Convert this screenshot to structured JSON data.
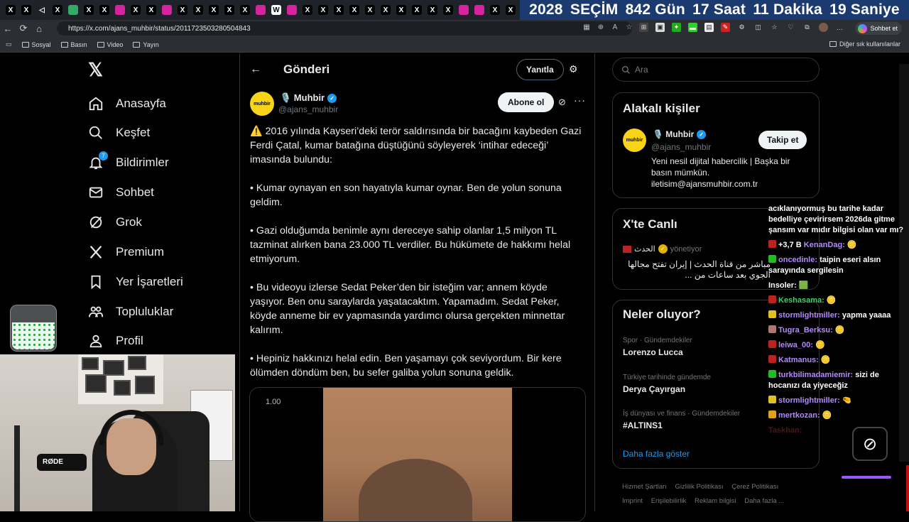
{
  "browser": {
    "tabs": [
      {
        "icon": "x-logo-icon",
        "label": "X"
      },
      {
        "icon": "x-logo-icon",
        "label": "X"
      },
      {
        "icon": "sound-icon",
        "label": ""
      },
      {
        "icon": "x-logo-icon",
        "label": "X"
      },
      {
        "icon": "bottle-icon",
        "label": ""
      },
      {
        "icon": "x-logo-icon",
        "label": "X"
      },
      {
        "icon": "x-logo-icon",
        "label": "X"
      },
      {
        "icon": "instagram-icon",
        "label": ""
      },
      {
        "icon": "x-logo-icon",
        "label": "X"
      },
      {
        "icon": "x-logo-icon",
        "label": "X"
      },
      {
        "icon": "instagram-icon",
        "label": ""
      },
      {
        "icon": "x-logo-icon",
        "label": "X"
      },
      {
        "icon": "x-logo-icon",
        "label": "X"
      },
      {
        "icon": "x-logo-icon",
        "label": "X"
      },
      {
        "icon": "x-logo-icon",
        "label": "X"
      },
      {
        "icon": "x-logo-icon",
        "label": "X"
      },
      {
        "icon": "instagram-icon",
        "label": ""
      },
      {
        "icon": "wikipedia-icon",
        "label": "W"
      },
      {
        "icon": "instagram-icon",
        "label": ""
      },
      {
        "icon": "x-logo-icon",
        "label": "X"
      },
      {
        "icon": "x-logo-icon",
        "label": "X"
      },
      {
        "icon": "x-logo-icon",
        "label": "X"
      },
      {
        "icon": "x-logo-icon",
        "label": "X"
      },
      {
        "icon": "x-logo-icon",
        "label": "X"
      },
      {
        "icon": "x-logo-icon",
        "label": "X"
      },
      {
        "icon": "x-logo-icon",
        "label": "X"
      },
      {
        "icon": "x-logo-icon",
        "label": "X"
      },
      {
        "icon": "x-logo-icon",
        "label": "X"
      },
      {
        "icon": "x-logo-icon",
        "label": "X"
      },
      {
        "icon": "instagram-icon",
        "label": ""
      },
      {
        "icon": "instagram-icon",
        "label": ""
      },
      {
        "icon": "x-logo-icon",
        "label": "X"
      },
      {
        "icon": "x-logo-icon",
        "label": "X"
      }
    ],
    "url": "https://x.com/ajans_muhbir/status/2011723503280504843",
    "copilot_label": "Sohbet et",
    "bookmarks": [
      "Sosyal",
      "Basın",
      "Video",
      "Yayın"
    ],
    "other_bookmarks": "Diğer sık kullanılanlar"
  },
  "countdown": {
    "year": "2028",
    "label": "SEÇİM",
    "days": "842 Gün",
    "hours": "17 Saat",
    "minutes": "11 Dakika",
    "seconds": "19 Saniye"
  },
  "sidebar": {
    "items": [
      {
        "label": "Anasayfa",
        "icon": "home-icon"
      },
      {
        "label": "Keşfet",
        "icon": "search-icon"
      },
      {
        "label": "Bildirimler",
        "icon": "bell-icon",
        "badge": "7"
      },
      {
        "label": "Sohbet",
        "icon": "envelope-icon"
      },
      {
        "label": "Grok",
        "icon": "grok-icon"
      },
      {
        "label": "Premium",
        "icon": "x-logo-icon"
      },
      {
        "label": "Yer İşaretleri",
        "icon": "bookmark-icon"
      },
      {
        "label": "Topluluklar",
        "icon": "people-icon"
      },
      {
        "label": "Profil",
        "icon": "person-icon"
      }
    ]
  },
  "post_header": {
    "title": "Gönderi",
    "reply_label": "Yanıtla"
  },
  "post": {
    "avatar_text": "muhbir",
    "author_name": "🎙️ Muhbir",
    "author_handle": "@ajans_muhbir",
    "subscribe_label": "Abone ol",
    "paragraphs": [
      "⚠️ 2016 yılında Kayseri’deki terör saldırısında bir bacağını kaybeden Gazi Ferdi Çatal, kumar batağına düştüğünü söyleyerek ‘intihar edeceği’ imasında bulundu:",
      "• Kumar oynayan en son hayatıyla kumar oynar. Ben de yolun sonuna geldim.",
      "• Gazi olduğumda benimle aynı dereceye sahip olanlar 1,5 milyon TL tazminat alırken bana 23.000 TL verdiler. Bu hükümete de hakkımı helal etmiyorum.",
      "• Bu videoyu izlerse Sedat Peker’den bir isteğim var; annem köyde yaşıyor. Ben onu saraylarda yaşatacaktım. Yapamadım. Sedat Peker, köyde anneme bir ev yapmasında yardımcı olursa gerçekten minnettar kalırım.",
      "• Hepiniz hakkınızı helal edin. Ben yaşamayı çok seviyordum. Bir kere ölümden döndüm ben, bu sefer galiba yolun sonuna geldik."
    ],
    "video_time": "1.00"
  },
  "right": {
    "search_placeholder": "Ara",
    "related_title": "Alakalı kişiler",
    "related": {
      "avatar_text": "muhbir",
      "name": "🎙️ Muhbir",
      "handle": "@ajans_muhbir",
      "follow_label": "Takip et",
      "bio": "Yeni nesil dijital habercilik | Başka bir basın mümkün. iletisim@ajansmuhbir.com.tr"
    },
    "live_title": "X'te Canlı",
    "live_source": "الحدث",
    "live_role": "yönetiyor",
    "live_text": "مباشر من قناة الحدث | إيران تفتح مجالها الجوي بعد ساعات من ...",
    "trends_title": "Neler oluyor?",
    "trends": [
      {
        "meta": "Spor · Gündemdekiler",
        "title": "Lorenzo Lucca"
      },
      {
        "meta": "Türkiye tarihinde gündemde",
        "title": "Derya Çayırgan"
      },
      {
        "meta": "İş dünyası ve finans · Gündemdekiler",
        "title": "#ALTINS1"
      }
    ],
    "show_more": "Daha fazla göster",
    "footer_links": [
      "Hizmet Şartları",
      "Gizlilik Politikası",
      "Çerez Politikası",
      "Imprint",
      "Erişilebilirlik",
      "Reklam bilgisi",
      "Daha fazla ..."
    ]
  },
  "stream": {
    "mic_brand": "RØDE",
    "chat_header": "acıklanıyormuş bu tarihe kadar bedelliye çevirirsem 2026da gitme şansım var mıdır bilgisi olan var mı?",
    "gift_count": "+3,7 B",
    "messages": [
      {
        "user": "KenanDag:",
        "text": "🪙"
      },
      {
        "user": "oncedinle:",
        "text": "taipin eseri alsın sarayında sergilesin"
      },
      {
        "user": "Insoler:",
        "text": "🟩"
      },
      {
        "user": "Keshasama:",
        "text": "🪙"
      },
      {
        "user": "stormlightmiller:",
        "text": "yapma yaaaa"
      },
      {
        "user": "Tugra_Berksu:",
        "text": "🪙"
      },
      {
        "user": "leiwa_00:",
        "text": "🪙"
      },
      {
        "user": "Katmanus:",
        "text": "🪙"
      },
      {
        "user": "turkbilimadamiemir:",
        "text": "sizi de hocanızı da yiyeceğiz"
      },
      {
        "user": "stormlightmiller:",
        "text": "🤏"
      },
      {
        "user": "mertkozan:",
        "text": "🪙"
      },
      {
        "user": "Taskhan:",
        "text": ""
      }
    ]
  }
}
